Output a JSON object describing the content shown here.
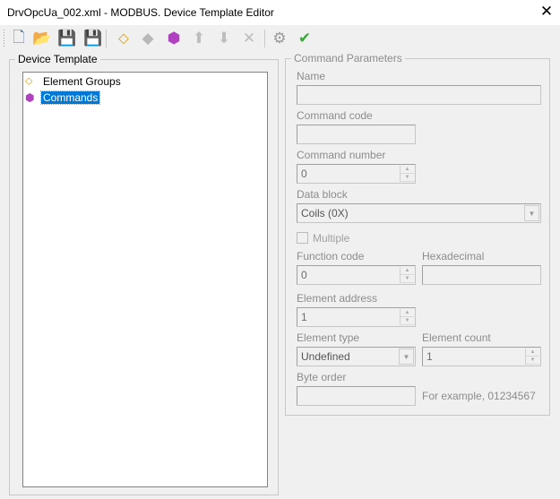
{
  "window": {
    "title": "DrvOpcUa_002.xml - MODBUS. Device Template Editor",
    "close_label": "✕"
  },
  "toolbar": [
    {
      "name": "new-file",
      "glyph": "🗋",
      "color": "#5a7ca8"
    },
    {
      "name": "open-folder",
      "glyph": "📂",
      "color": "#d9a53b"
    },
    {
      "name": "save",
      "glyph": "💾",
      "color": "#aaaaaa"
    },
    {
      "name": "save-as",
      "glyph": "💾",
      "color": "#3a3aa8"
    },
    {
      "name": "add-element-group",
      "glyph": "⬦",
      "color": "#d4a017"
    },
    {
      "name": "add-element",
      "glyph": "◆",
      "color": "#b8b8b8"
    },
    {
      "name": "add-command",
      "glyph": "⬢",
      "color": "#b040c0"
    },
    {
      "name": "move-up",
      "glyph": "⬆",
      "color": "#bdbdbd"
    },
    {
      "name": "move-down",
      "glyph": "⬇",
      "color": "#bdbdbd"
    },
    {
      "name": "delete",
      "glyph": "✕",
      "color": "#bdbdbd"
    },
    {
      "name": "settings",
      "glyph": "⚙",
      "color": "#9a9a9a"
    },
    {
      "name": "validate",
      "glyph": "✔",
      "color": "#3aa83a"
    }
  ],
  "tree": {
    "title": "Device Template",
    "nodes": [
      {
        "label": "Element Groups",
        "selected": false
      },
      {
        "label": "Commands",
        "selected": true
      }
    ]
  },
  "params": {
    "title": "Command Parameters",
    "name_label": "Name",
    "name_value": "",
    "command_code_label": "Command code",
    "command_code_value": "",
    "command_number_label": "Command number",
    "command_number_value": "0",
    "data_block_label": "Data block",
    "data_block_value": "Coils (0X)",
    "multiple_label": "Multiple",
    "multiple_checked": false,
    "function_code_label": "Function code",
    "function_code_value": "0",
    "hexadecimal_label": "Hexadecimal",
    "hexadecimal_value": "",
    "element_address_label": "Element address",
    "element_address_value": "1",
    "element_type_label": "Element type",
    "element_type_value": "Undefined",
    "element_count_label": "Element count",
    "element_count_value": "1",
    "byte_order_label": "Byte order",
    "byte_order_value": "",
    "byte_order_hint": "For example, 01234567"
  }
}
